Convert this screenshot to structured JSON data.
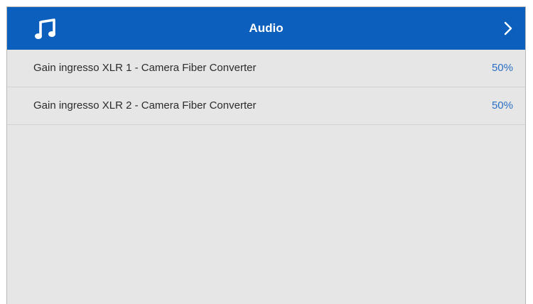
{
  "header": {
    "title": "Audio",
    "icon": "music-note-icon",
    "next_icon": "chevron-right-icon",
    "background_color": "#0c5fbd"
  },
  "settings": [
    {
      "label": "Gain ingresso XLR 1 - Camera Fiber Converter",
      "value": "50%"
    },
    {
      "label": "Gain ingresso XLR 2 - Camera Fiber Converter",
      "value": "50%"
    }
  ],
  "colors": {
    "panel_background": "#e6e6e6",
    "value_text": "#2a6fc4"
  }
}
